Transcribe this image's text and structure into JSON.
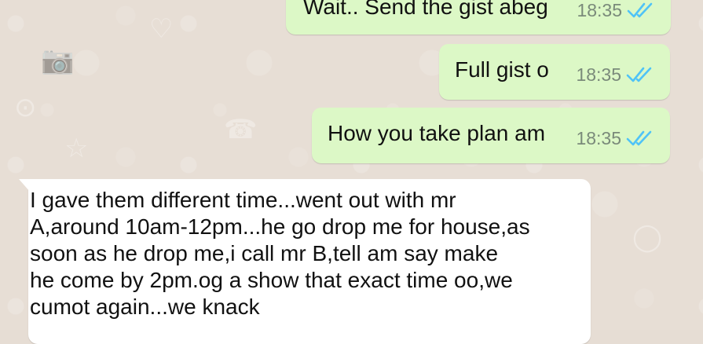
{
  "chat": {
    "messages": [
      {
        "direction": "outgoing",
        "text": "Wait.. Send the gist abeg",
        "time": "18:35",
        "status": "read"
      },
      {
        "direction": "outgoing",
        "text": "Full gist o",
        "time": "18:35",
        "status": "read"
      },
      {
        "direction": "outgoing",
        "text": "How you take plan am",
        "time": "18:35",
        "status": "read"
      },
      {
        "direction": "incoming",
        "lines": [
          "I gave them different time...went out with mr",
          "A,around 10am-12pm...he go drop me for house,as",
          "soon as he drop me,i call mr B,tell am say make",
          "he come by 2pm.og a show that exact time oo,we",
          "cumot again...we knack"
        ]
      }
    ]
  },
  "icons": {
    "read_receipt": "double-check-icon",
    "wallpaper": [
      "heart-icon",
      "camera-icon",
      "phone-icon",
      "star-icon",
      "person-icon",
      "compass-icon"
    ]
  },
  "colors": {
    "outgoing_bubble": "#dcf8c6",
    "incoming_bubble": "#ffffff",
    "read_tick": "#4fc3f7",
    "time_text": "#7a8a7a",
    "wallpaper": "#e7ded5"
  }
}
